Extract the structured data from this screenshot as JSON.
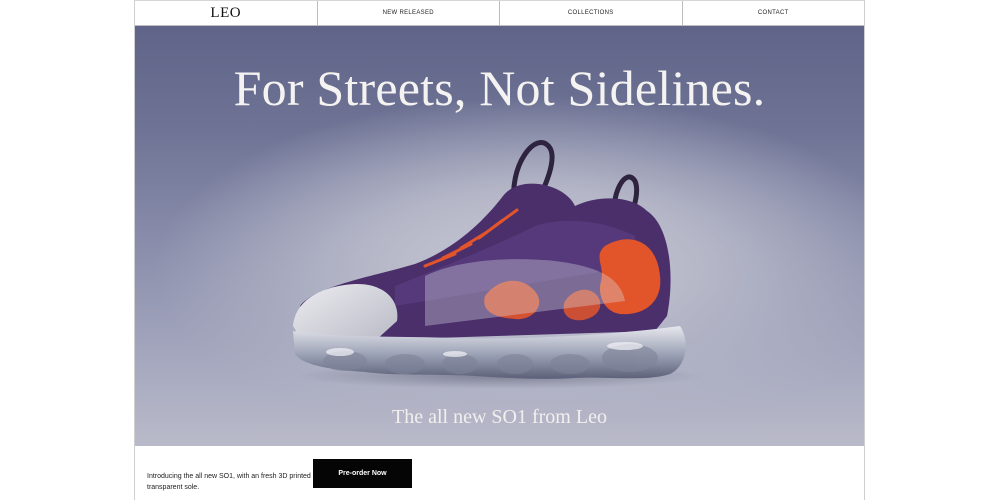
{
  "nav": {
    "brand": "LEO",
    "links": [
      "NEW RELEASED",
      "COLLECTIONS",
      "CONTACT"
    ]
  },
  "hero": {
    "title": "For Streets, Not Sidelines.",
    "subtitle": "The all new SO1 from Leo",
    "image": "sneaker-photo"
  },
  "promo": {
    "text": "Introducing the all new SO1, with an fresh 3D printed transparent sole.",
    "cta_label": "Pre-order Now"
  },
  "colors": {
    "hero_bg": "#6f7496",
    "shoe_purple": "#4a2f6b",
    "shoe_orange": "#e2552a",
    "cta_bg": "#050505"
  }
}
